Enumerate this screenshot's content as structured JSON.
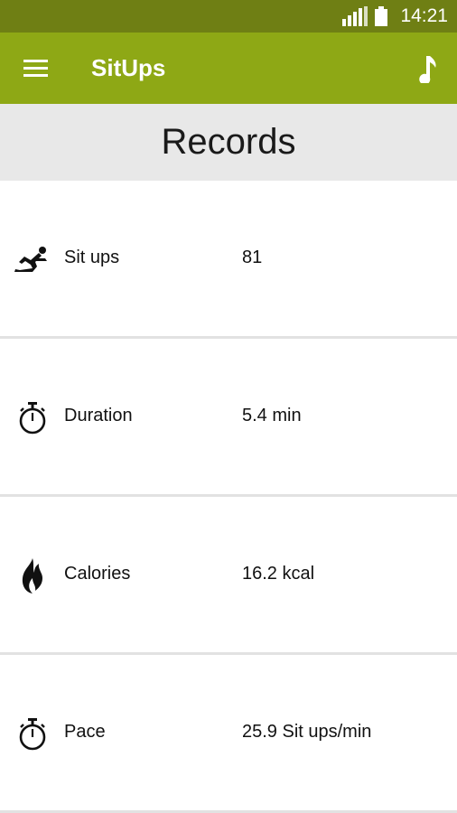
{
  "status_bar": {
    "time": "14:21",
    "signal_icon": "signal-icon",
    "battery_icon": "battery-icon"
  },
  "app_bar": {
    "title": "SitUps",
    "menu_icon": "menu-icon",
    "music_icon": "music-note-icon",
    "color": "#8ea815"
  },
  "header": {
    "title": "Records"
  },
  "records": [
    {
      "icon": "situp-icon",
      "label": "Sit ups",
      "value": "81"
    },
    {
      "icon": "stopwatch-icon",
      "label": "Duration",
      "value": "5.4 min"
    },
    {
      "icon": "flame-icon",
      "label": "Calories",
      "value": "16.2 kcal"
    },
    {
      "icon": "stopwatch-icon",
      "label": "Pace",
      "value": "25.9 Sit ups/min"
    }
  ]
}
